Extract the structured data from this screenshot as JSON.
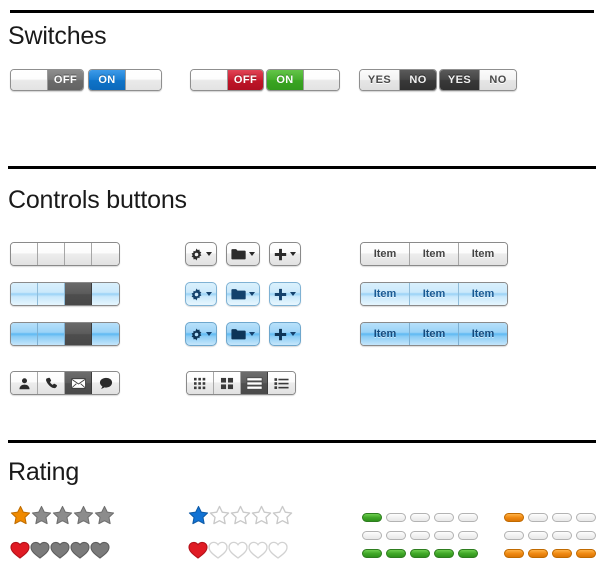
{
  "sections": [
    {
      "id": "switches",
      "title": "Switches"
    },
    {
      "id": "controls",
      "title": "Controls buttons"
    },
    {
      "id": "rating",
      "title": "Rating"
    }
  ],
  "switches": {
    "items": [
      {
        "name": "switch-gray-off",
        "left_label": "",
        "right_label": "OFF",
        "state": "off",
        "style": "gray"
      },
      {
        "name": "switch-blue-on",
        "left_label": "ON",
        "right_label": "",
        "state": "on",
        "style": "blue"
      },
      {
        "name": "switch-red-off",
        "left_label": "",
        "right_label": "OFF",
        "state": "off",
        "style": "red"
      },
      {
        "name": "switch-green-on",
        "left_label": "ON",
        "right_label": "",
        "state": "on",
        "style": "green"
      },
      {
        "name": "switch-yesno-yes",
        "left_label": "YES",
        "right_label": "NO",
        "state": "yes",
        "style": "dark"
      },
      {
        "name": "switch-yesno-no",
        "left_label": "YES",
        "right_label": "NO",
        "state": "no",
        "style": "dark"
      }
    ],
    "colors": {
      "gray": "#6b6b6b",
      "blue": "#0f73c8",
      "red": "#bf1528",
      "green": "#3aa522",
      "dark": "#393939"
    }
  },
  "controls": {
    "plain_groups": [
      {
        "name": "segmented-group-plain",
        "style": "gray",
        "segments": [
          "",
          "",
          "",
          ""
        ],
        "selected": -1
      },
      {
        "name": "segmented-group-blue-light",
        "style": "blue-light",
        "segments": [
          "",
          "",
          "",
          ""
        ],
        "selected": 2
      },
      {
        "name": "segmented-group-blue-medium",
        "style": "blue-medium",
        "segments": [
          "",
          "",
          "",
          ""
        ],
        "selected": 2
      }
    ],
    "icon_buttons": [
      {
        "name": "gear-dropdown-button",
        "icon": "gear-icon",
        "style": "gray",
        "has_caret": true
      },
      {
        "name": "folder-dropdown-button",
        "icon": "folder-icon",
        "style": "gray",
        "has_caret": true
      },
      {
        "name": "plus-dropdown-button",
        "icon": "plus-icon",
        "style": "gray",
        "has_caret": true
      },
      {
        "name": "gear-dropdown-button",
        "icon": "gear-icon",
        "style": "blue-light",
        "has_caret": true
      },
      {
        "name": "folder-dropdown-button",
        "icon": "folder-icon",
        "style": "blue-light",
        "has_caret": true
      },
      {
        "name": "plus-dropdown-button",
        "icon": "plus-icon",
        "style": "blue-light",
        "has_caret": true
      },
      {
        "name": "gear-dropdown-button",
        "icon": "gear-icon",
        "style": "blue-medium",
        "has_caret": true
      },
      {
        "name": "folder-dropdown-button",
        "icon": "folder-icon",
        "style": "blue-medium",
        "has_caret": true
      },
      {
        "name": "plus-dropdown-button",
        "icon": "plus-icon",
        "style": "blue-medium",
        "has_caret": true
      }
    ],
    "item_groups": [
      {
        "name": "item-group-plain",
        "style": "gray",
        "items": [
          "Item",
          "Item",
          "Item"
        ]
      },
      {
        "name": "item-group-blue-light",
        "style": "blue-light",
        "items": [
          "Item",
          "Item",
          "Item"
        ]
      },
      {
        "name": "item-group-blue-medium",
        "style": "blue-medium",
        "items": [
          "Item",
          "Item",
          "Item"
        ]
      }
    ],
    "contact_toolbar": {
      "name": "contact-icon-toolbar",
      "icons": [
        "person-icon",
        "phone-icon",
        "envelope-icon",
        "chat-bubble-icon"
      ],
      "selected": 2
    },
    "view_toolbar": {
      "name": "view-mode-toolbar",
      "icons": [
        "grid-small-icon",
        "grid-large-icon",
        "list-rows-icon",
        "list-detail-icon"
      ],
      "selected": 2
    }
  },
  "rating": {
    "rows": [
      {
        "name": "star-rating-gray",
        "shape": "star",
        "total": 5,
        "filled": 1,
        "fill_color": "#f08a00",
        "empty_color": "#8c8c8c",
        "empty_style": "solid"
      },
      {
        "name": "heart-rating-gray",
        "shape": "heart",
        "total": 5,
        "filled": 1,
        "fill_color": "#e01b24",
        "empty_color": "#7a7a7a",
        "empty_style": "solid"
      },
      {
        "name": "star-rating-blue",
        "shape": "star",
        "total": 5,
        "filled": 1,
        "fill_color": "#1273d4",
        "empty_color": "#c9c9c9",
        "empty_style": "outline"
      },
      {
        "name": "heart-rating-red",
        "shape": "heart",
        "total": 5,
        "filled": 1,
        "fill_color": "#e01b24",
        "empty_color": "#d2d2d2",
        "empty_style": "outline"
      }
    ],
    "bars": [
      {
        "name": "bar-rating-green-1",
        "color": "green",
        "total": 5,
        "filled": 1
      },
      {
        "name": "bar-rating-green-0",
        "color": "green",
        "total": 5,
        "filled": 0
      },
      {
        "name": "bar-rating-green-5",
        "color": "green",
        "total": 5,
        "filled": 5
      },
      {
        "name": "bar-rating-orange-1",
        "color": "orange",
        "total": 5,
        "filled": 1
      },
      {
        "name": "bar-rating-orange-0",
        "color": "orange",
        "total": 5,
        "filled": 0
      },
      {
        "name": "bar-rating-orange-5",
        "color": "orange",
        "total": 5,
        "filled": 5
      }
    ],
    "colors": {
      "green": "#41a828",
      "orange": "#f08a13",
      "star_on": "#f08a00",
      "heart_on": "#e01b24",
      "star_blue": "#1273d4"
    }
  }
}
